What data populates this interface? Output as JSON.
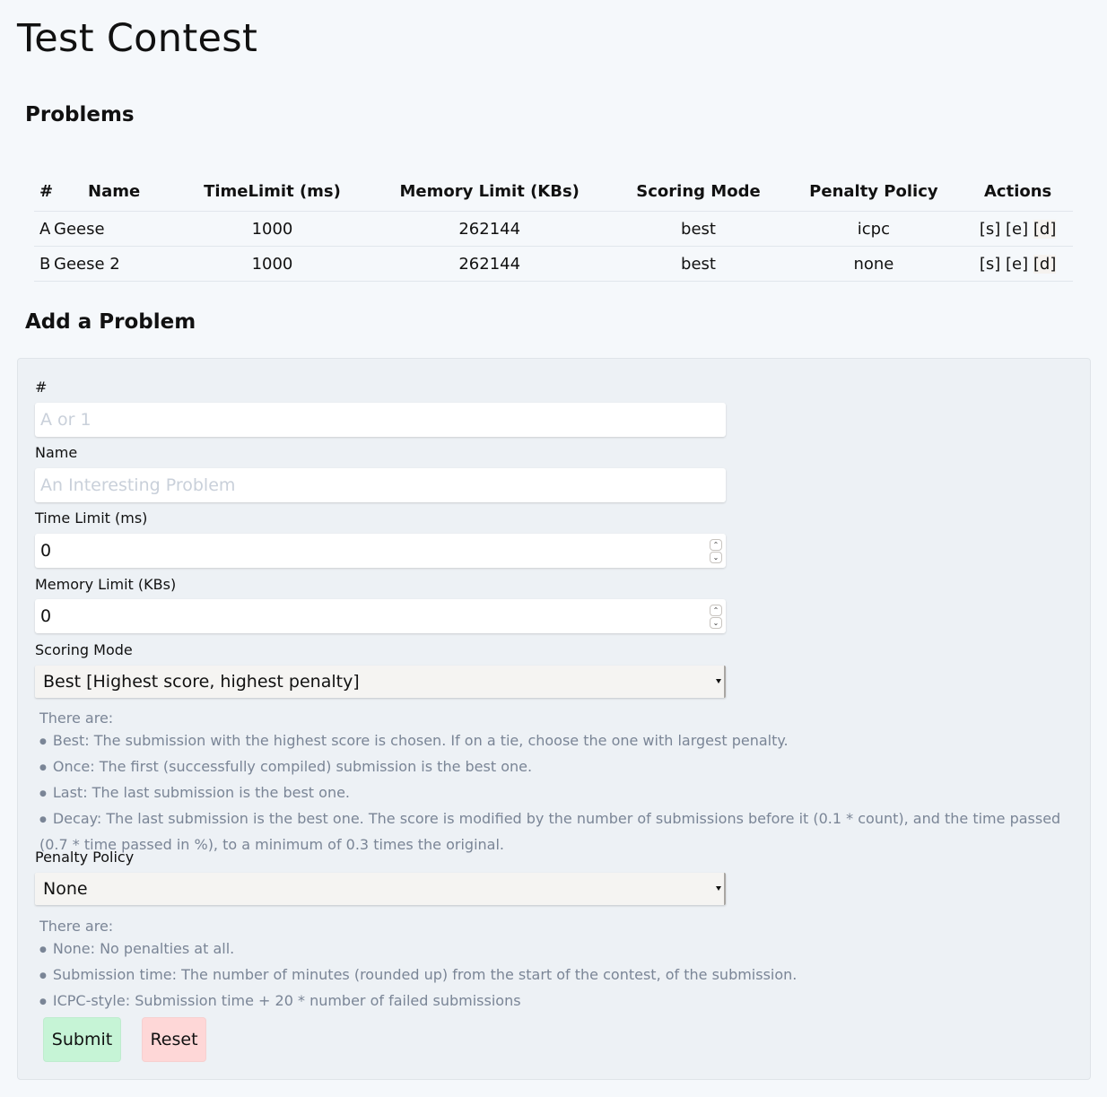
{
  "page": {
    "title": "Test Contest"
  },
  "problems": {
    "title": "Problems",
    "columns": [
      "#",
      "Name",
      "TimeLimit (ms)",
      "Memory Limit (KBs)",
      "Scoring Mode",
      "Penalty Policy",
      "Actions"
    ],
    "rows": [
      {
        "id": "A",
        "name": "Geese",
        "time_limit": "1000",
        "memory_limit": "262144",
        "scoring_mode": "best",
        "penalty_policy": "icpc",
        "actions": [
          "[s]",
          "[e]",
          "[d]"
        ]
      },
      {
        "id": "B",
        "name": "Geese 2",
        "time_limit": "1000",
        "memory_limit": "262144",
        "scoring_mode": "best",
        "penalty_policy": "none",
        "actions": [
          "[s]",
          "[e]",
          "[d]"
        ]
      }
    ]
  },
  "add_problem": {
    "title": "Add a Problem",
    "fields": {
      "id": {
        "label": "#",
        "value": "",
        "placeholder": "A or 1"
      },
      "name": {
        "label": "Name",
        "value": "",
        "placeholder": "An Interesting Problem"
      },
      "time_limit": {
        "label": "Time Limit (ms)",
        "value": "0"
      },
      "memory_limit": {
        "label": "Memory Limit (KBs)",
        "value": "0"
      },
      "scoring_mode": {
        "label": "Scoring Mode",
        "selected": "Best [Highest score, highest penalty]",
        "help_intro": "There are:",
        "help_items": [
          "Best: The submission with the highest score is chosen. If on a tie, choose the one with largest penalty.",
          "Once: The first (successfully compiled) submission is the best one.",
          "Last: The last submission is the best one.",
          "Decay: The last submission is the best one. The score is modified by the number of submissions before it (0.1 * count), and the time passed (0.7 * time passed in %), to a minimum of 0.3 times the original."
        ]
      },
      "penalty_policy": {
        "label": "Penalty Policy",
        "selected": "None",
        "help_intro": "There are:",
        "help_items": [
          "None: No penalties at all.",
          "Submission time: The number of minutes (rounded up) from the start of the contest, of the submission.",
          "ICPC-style: Submission time + 20 * number of failed submissions"
        ]
      }
    },
    "buttons": {
      "submit": "Submit",
      "reset": "Reset"
    },
    "colors": {
      "submit_bg": "#c6f4d6",
      "reset_bg": "#fed7d7"
    }
  }
}
